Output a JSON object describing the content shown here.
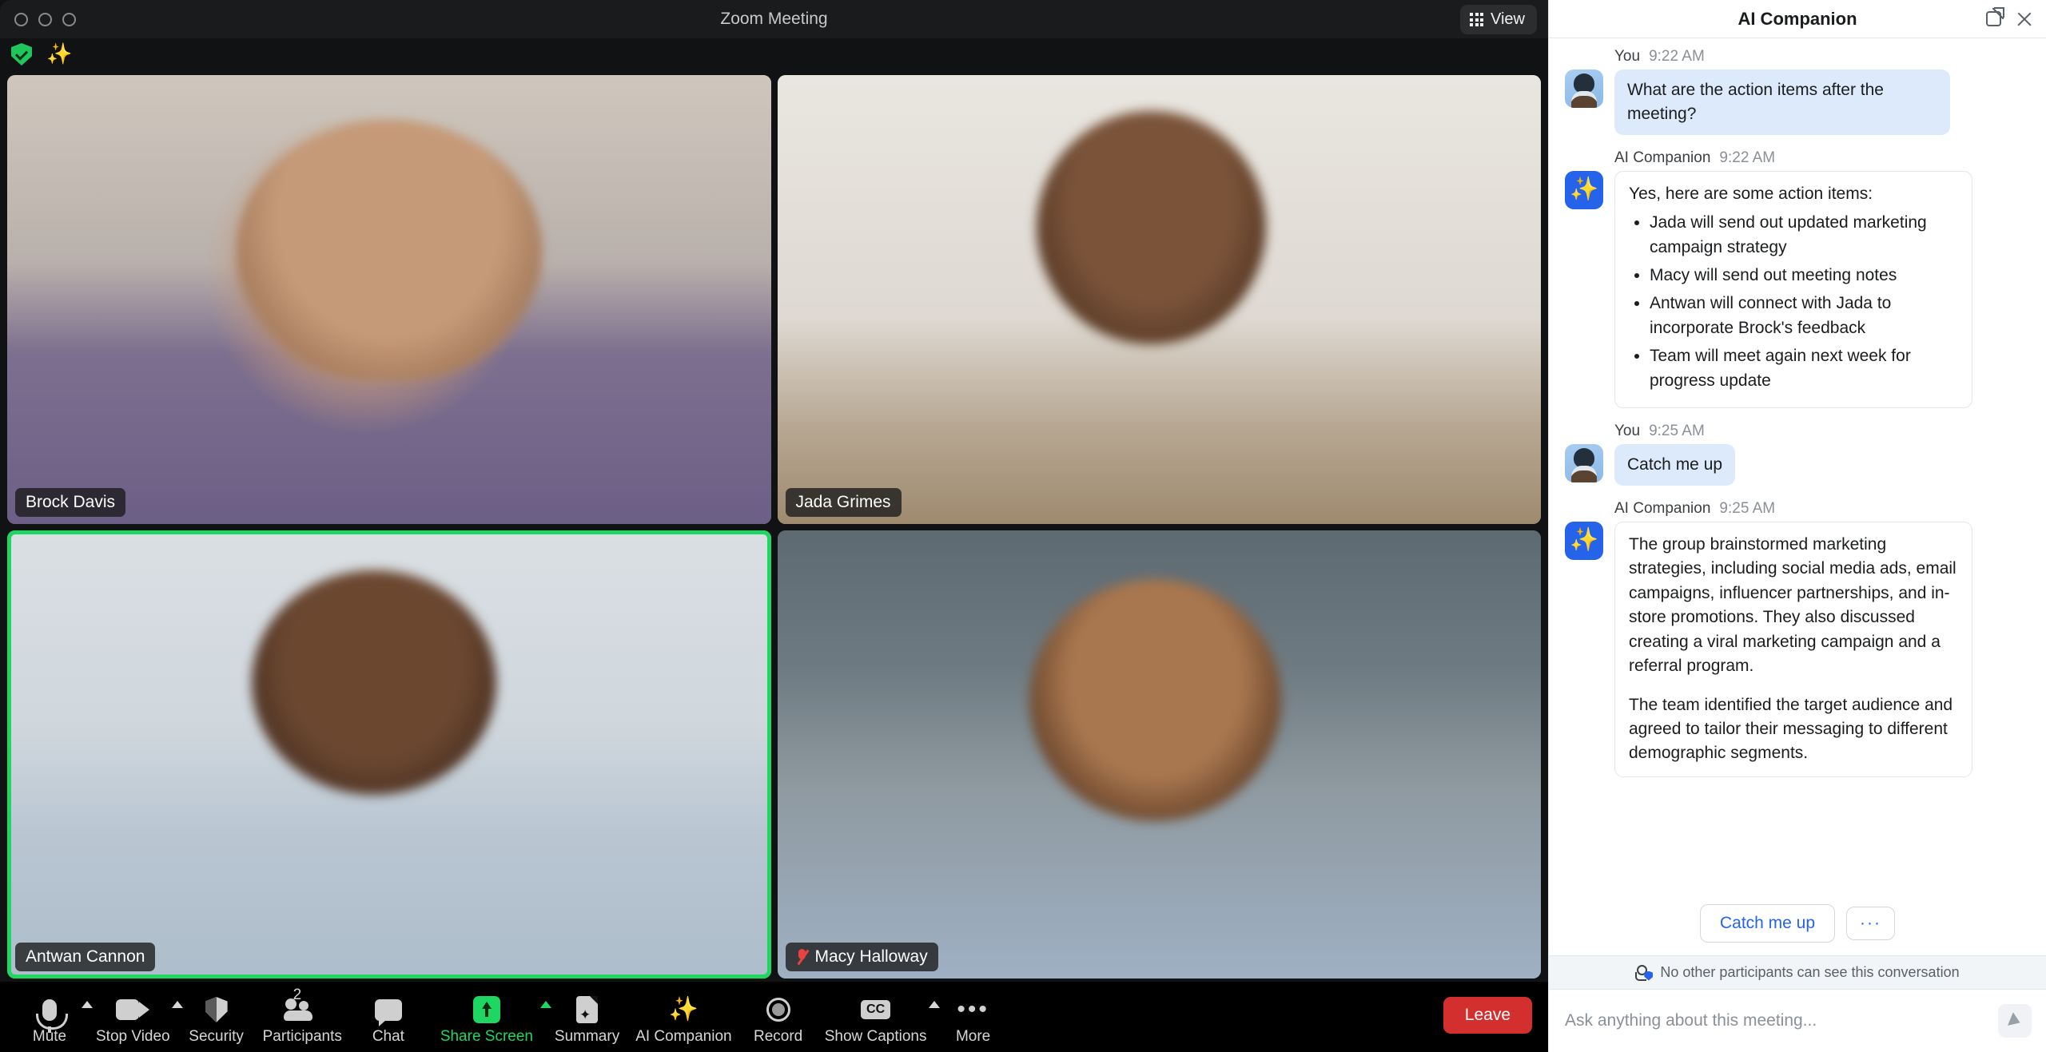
{
  "window": {
    "title": "Zoom Meeting",
    "view_button": "View",
    "view_icon": "grid-icon",
    "traffic_lights": [
      "close",
      "minimize",
      "maximize"
    ]
  },
  "status_indicators": [
    {
      "icon": "encryption-shield-icon",
      "name": "encryption-status"
    },
    {
      "icon": "ai-sparkle-icon",
      "name": "ai-companion-active"
    }
  ],
  "gallery": {
    "tiles": [
      {
        "name": "Brock Davis",
        "active_speaker": false,
        "muted": false,
        "video_class": "v-brock"
      },
      {
        "name": "Jada Grimes",
        "active_speaker": false,
        "muted": false,
        "video_class": "v-jada"
      },
      {
        "name": "Antwan Cannon",
        "active_speaker": true,
        "muted": false,
        "video_class": "v-antwan"
      },
      {
        "name": "Macy Halloway",
        "active_speaker": false,
        "muted": true,
        "video_class": "v-macy"
      }
    ]
  },
  "toolbar": {
    "items": [
      {
        "label": "Mute",
        "icon": "microphone-icon",
        "caret": true,
        "highlight": false
      },
      {
        "label": "Stop Video",
        "icon": "camera-icon",
        "caret": true,
        "highlight": false
      },
      {
        "label": "Security",
        "icon": "shield-icon",
        "caret": false,
        "highlight": false
      },
      {
        "label": "Participants",
        "icon": "people-icon",
        "caret": false,
        "highlight": false,
        "badge": "2"
      },
      {
        "label": "Chat",
        "icon": "chat-bubble-icon",
        "caret": false,
        "highlight": false
      },
      {
        "label": "Share Screen",
        "icon": "share-screen-icon",
        "caret": true,
        "highlight": true
      },
      {
        "label": "Summary",
        "icon": "summary-doc-icon",
        "caret": false,
        "highlight": false
      },
      {
        "label": "AI Companion",
        "icon": "ai-sparkle-icon",
        "caret": false,
        "highlight": false
      },
      {
        "label": "Record",
        "icon": "record-circle-icon",
        "caret": false,
        "highlight": false
      },
      {
        "label": "Show Captions",
        "icon": "closed-captions-icon",
        "caret": true,
        "highlight": false
      },
      {
        "label": "More",
        "icon": "ellipsis-icon",
        "caret": false,
        "highlight": false
      }
    ],
    "leave_label": "Leave"
  },
  "panel": {
    "title": "AI Companion",
    "popout_icon": "open-in-new-icon",
    "close_icon": "close-icon",
    "messages": [
      {
        "author": "You",
        "time": "9:22 AM",
        "role": "user",
        "text": "What are the action items after the meeting?"
      },
      {
        "author": "AI Companion",
        "time": "9:22 AM",
        "role": "ai",
        "intro": "Yes, here are some action items:",
        "bullets": [
          "Jada will send out updated marketing campaign strategy",
          "Macy will send out meeting notes",
          "Antwan will connect with Jada to incorporate Brock's feedback",
          "Team will meet again next week for progress update"
        ]
      },
      {
        "author": "You",
        "time": "9:25 AM",
        "role": "user",
        "text": "Catch me up"
      },
      {
        "author": "AI Companion",
        "time": "9:25 AM",
        "role": "ai",
        "paragraphs": [
          "The group brainstormed marketing strategies, including social media ads, email campaigns, influencer partnerships, and in-store promotions. They also discussed creating a viral marketing campaign and a referral program.",
          "The team identified the target audience and agreed to tailor their messaging to different demographic segments."
        ]
      }
    ],
    "quick_actions": {
      "primary": "Catch me up",
      "more": "···"
    },
    "privacy_note": "No other participants can see this conversation",
    "privacy_icon": "participant-privacy-icon",
    "composer": {
      "placeholder": "Ask anything about this meeting...",
      "value": "",
      "send_icon": "send-icon"
    }
  },
  "colors": {
    "accent_blue": "#2563eb",
    "active_green": "#1ed760",
    "leave_red": "#d32f2f",
    "user_bubble": "#dceafb"
  }
}
